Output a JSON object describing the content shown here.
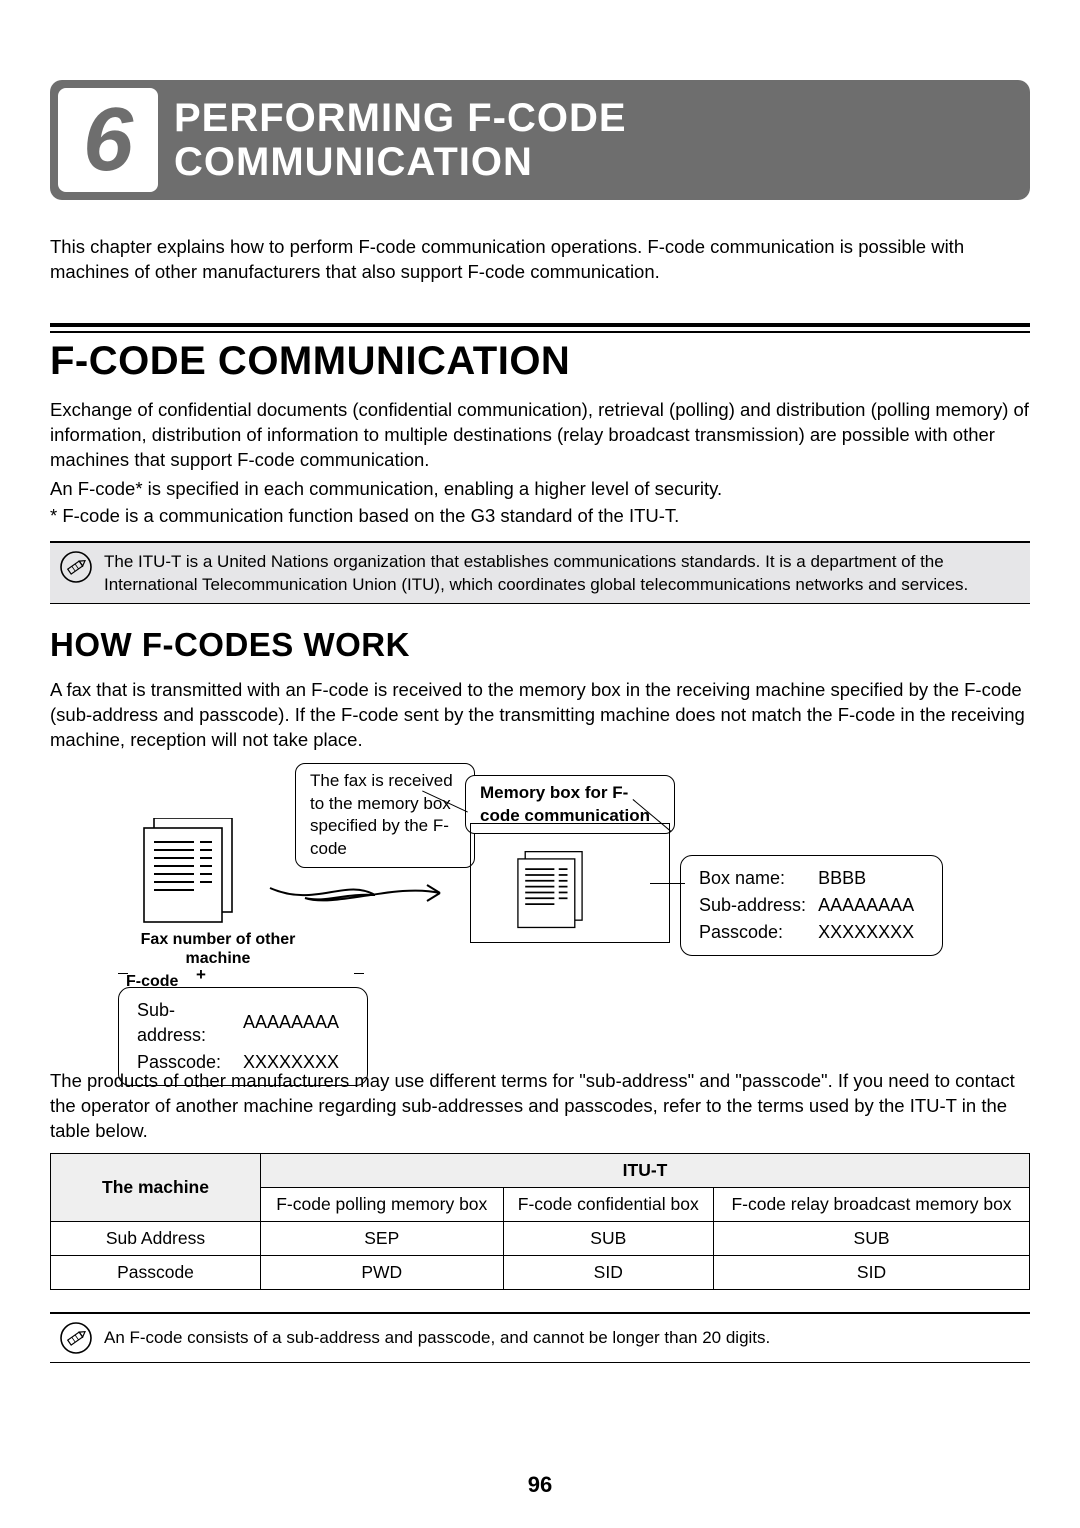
{
  "chapter": {
    "number": "6",
    "title_line1": "PERFORMING F-CODE",
    "title_line2": "COMMUNICATION"
  },
  "intro": "This chapter explains how to perform F-code communication operations. F-code communication is possible with machines of other manufacturers that also support F-code communication.",
  "h1": "F-CODE COMMUNICATION",
  "p1": "Exchange of confidential documents (confidential communication), retrieval (polling) and distribution (polling memory) of information, distribution of information to multiple destinations (relay broadcast transmission) are possible with other machines that support F-code communication.",
  "p2": "An F-code* is specified in each communication, enabling a higher level of security.",
  "p3": "*  F-code is a communication function based on the G3 standard of the ITU-T.",
  "note1": "The ITU-T is a United Nations organization that establishes communications standards. It is a department of the International Telecommunication Union (ITU), which coordinates global telecommunications networks and services.",
  "h2": "HOW F-CODES WORK",
  "p4": "A fax that is transmitted with an F-code is received to the memory box in the receiving machine specified by the F-code (sub-address and passcode). If the F-code sent by the transmitting machine does not match the F-code in the receiving machine, reception will not take place.",
  "dia": {
    "callout_a": "The fax is received to the memory box specified by the F-code",
    "callout_b": "Memory box for F-code communication",
    "fax_caption": "Fax number of other machine",
    "plus": "+",
    "fcode_label": "F-code",
    "fcode_box": {
      "sub_label": "Sub-address:",
      "sub_val": "AAAAAAAA",
      "pass_label": "Passcode:",
      "pass_val": "XXXXXXXX"
    },
    "boxinfo": {
      "name_label": "Box name:",
      "name_val": "BBBB",
      "sub_label": "Sub-address:",
      "sub_val": "AAAAAAAA",
      "pass_label": "Passcode:",
      "pass_val": "XXXXXXXX"
    }
  },
  "below": "The products of other manufacturers may use different terms for \"sub-address\" and \"passcode\". If you need to contact the operator of another machine regarding sub-addresses and passcodes, refer to the terms used by the ITU-T in the table below.",
  "table": {
    "headers": {
      "machine": "The machine",
      "itu": "ITU-T"
    },
    "subheaders": [
      "F-code polling memory box",
      "F-code confidential box",
      "F-code relay broadcast memory box"
    ],
    "rows": [
      {
        "label": "Sub Address",
        "cells": [
          "SEP",
          "SUB",
          "SUB"
        ]
      },
      {
        "label": "Passcode",
        "cells": [
          "PWD",
          "SID",
          "SID"
        ]
      }
    ]
  },
  "note2": "An F-code consists of a sub-address and passcode, and cannot be longer than 20 digits.",
  "page_number": "96"
}
